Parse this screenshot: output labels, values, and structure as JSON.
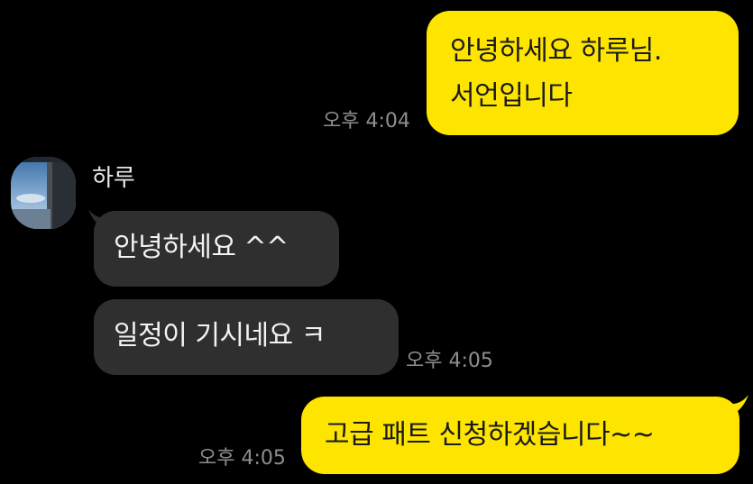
{
  "conversation": {
    "messages": [
      {
        "sender": "me",
        "lines": [
          "안녕하세요 하루님.",
          "서언입니다"
        ],
        "time": "오후 4:04"
      },
      {
        "sender": "other",
        "name": "하루",
        "bubbles": [
          "안녕하세요 ^^",
          "일정이 기시네요 ㅋ"
        ],
        "time": "오후 4:05"
      },
      {
        "sender": "me",
        "lines": [
          "고급 패트 신청하겠습니다~~"
        ],
        "time": "오후 4:05"
      }
    ]
  },
  "colors": {
    "background": "#000000",
    "my_bubble": "#FEE500",
    "other_bubble": "#2F2F2F",
    "timestamp": "#8E8E8E"
  },
  "icons": {
    "avatar": "window-sky-photo"
  }
}
